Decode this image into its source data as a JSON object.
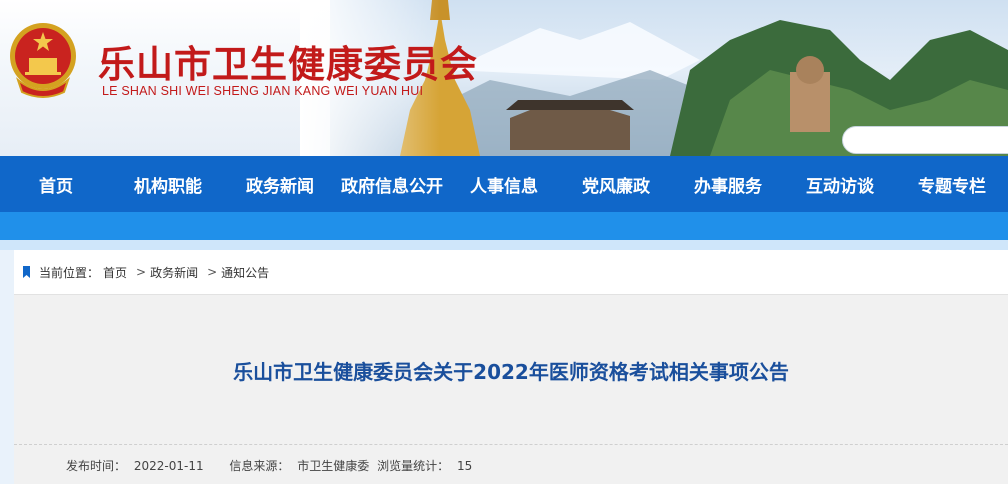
{
  "header": {
    "title": "乐山市卫生健康委员会",
    "subtitle": "LE SHAN SHI WEI SHENG JIAN KANG WEI YUAN HUI"
  },
  "nav": {
    "items": [
      "首页",
      "机构职能",
      "政务新闻",
      "政府信息公开",
      "人事信息",
      "党风廉政",
      "办事服务",
      "互动访谈",
      "专题专栏"
    ]
  },
  "breadcrumb": {
    "label": "当前位置：",
    "items": [
      "首页",
      "政务新闻",
      "通知公告"
    ],
    "separator": ">"
  },
  "article": {
    "title": "乐山市卫生健康委员会关于2022年医师资格考试相关事项公告",
    "meta": {
      "publish_label": "发布时间：",
      "publish_date": "2022-01-11",
      "source_label": "信息来源：",
      "source": "市卫生健康委",
      "views_label": "浏览量统计：",
      "views": "15"
    }
  },
  "colors": {
    "title_red": "#c21a1a",
    "nav_blue": "#1067c9",
    "nav_strip": "#2090ea",
    "article_title": "#1a4f9c"
  }
}
